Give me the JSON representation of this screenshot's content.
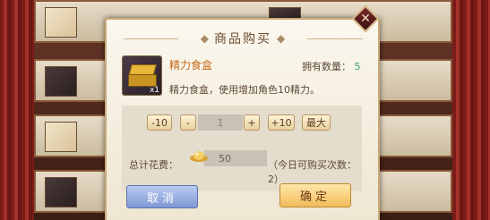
{
  "dialog": {
    "title": "商品购买",
    "close_icon": "close-icon"
  },
  "item": {
    "name": "精力食盒",
    "count": "x1",
    "owned_label": "拥有数量：",
    "owned_value": "5",
    "description": "精力食盒，使用增加角色10精力。"
  },
  "quantity": {
    "minus10": "-10",
    "minus1": "-",
    "value": "1",
    "plus1": "+",
    "plus10": "+10",
    "max": "最大"
  },
  "cost": {
    "label": "总计花费：",
    "value": "50",
    "daily_limit": "（今日可购买次数：2）"
  },
  "buttons": {
    "cancel": "取消",
    "confirm": "确定"
  },
  "colors": {
    "item_name": "#c46a1a",
    "owned_value": "#3aa06a",
    "cancel_button": "#8fa6dd",
    "confirm_button": "#f1bb5b"
  }
}
